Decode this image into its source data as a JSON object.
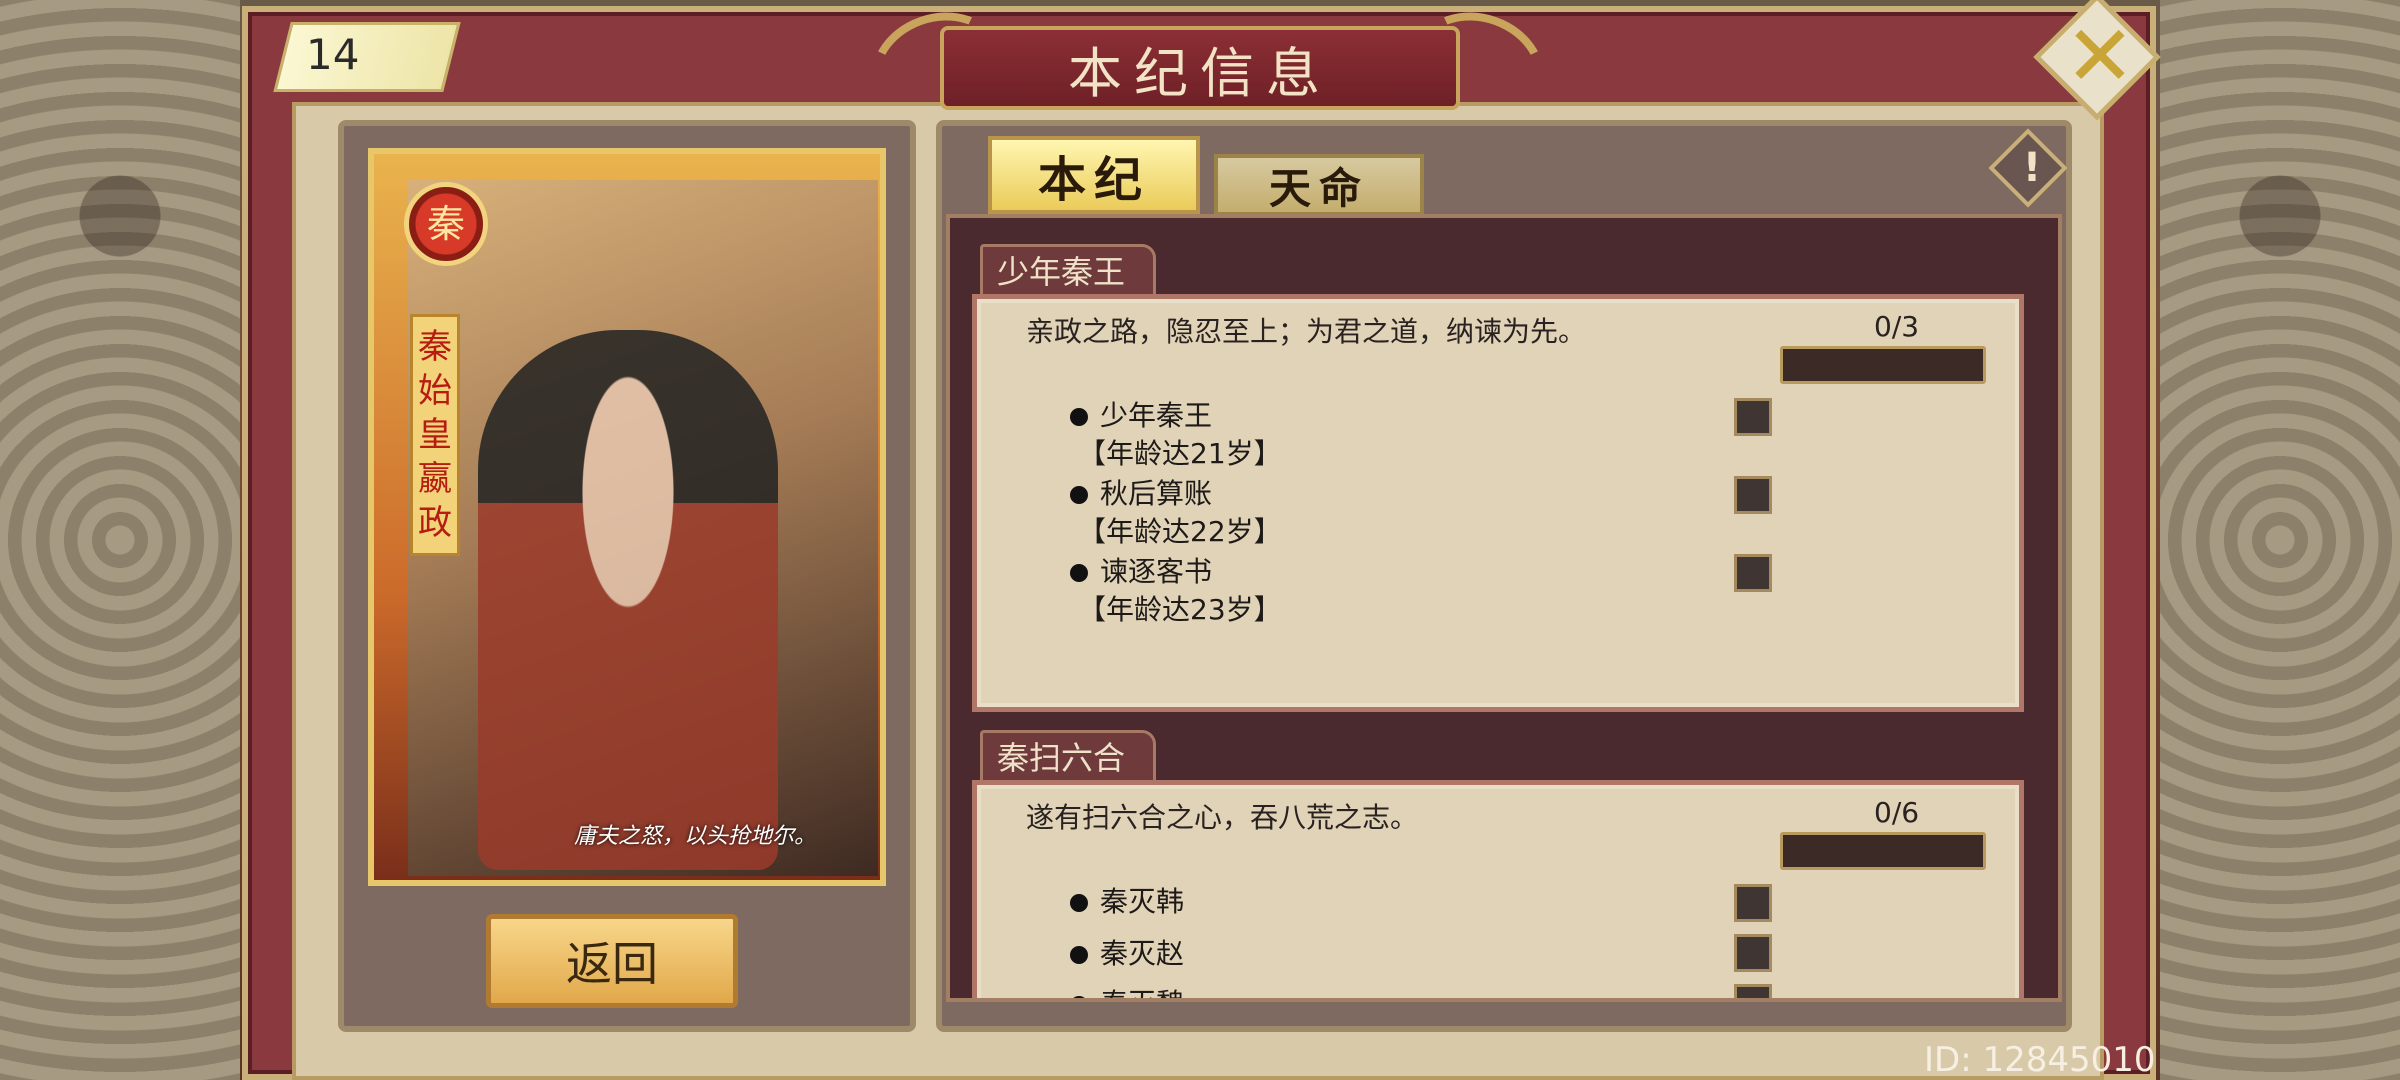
{
  "header": {
    "title": "本纪信息",
    "level": "14"
  },
  "card": {
    "badge": "秦",
    "name": "秦始皇",
    "hero": "嬴政",
    "quote": "庸夫之怒，以头抢地尔。"
  },
  "left": {
    "back_label": "返回"
  },
  "tabs": [
    {
      "label": "本纪",
      "active": true
    },
    {
      "label": "天命",
      "active": false
    }
  ],
  "sections": [
    {
      "title": "少年秦王",
      "desc": "亲政之路，隐忍至上；为君之道，纳谏为先。",
      "progress": "0/3",
      "progress_fraction": 0,
      "items": [
        {
          "name": "少年秦王",
          "req": "【年龄达21岁】"
        },
        {
          "name": "秋后算账",
          "req": "【年龄达22岁】"
        },
        {
          "name": "谏逐客书",
          "req": "【年龄达23岁】"
        }
      ]
    },
    {
      "title": "秦扫六合",
      "desc": "遂有扫六合之心，吞八荒之志。",
      "progress": "0/6",
      "progress_fraction": 0,
      "items": [
        {
          "name": "秦灭韩"
        },
        {
          "name": "秦灭赵"
        },
        {
          "name": "秦灭魏"
        }
      ]
    }
  ],
  "footer": {
    "id": "ID: 12845010"
  },
  "colors": {
    "frame": "#8a3a3e",
    "gold": "#c9a45c",
    "panel": "#7e6a61",
    "paper": "#e0d3b8"
  }
}
